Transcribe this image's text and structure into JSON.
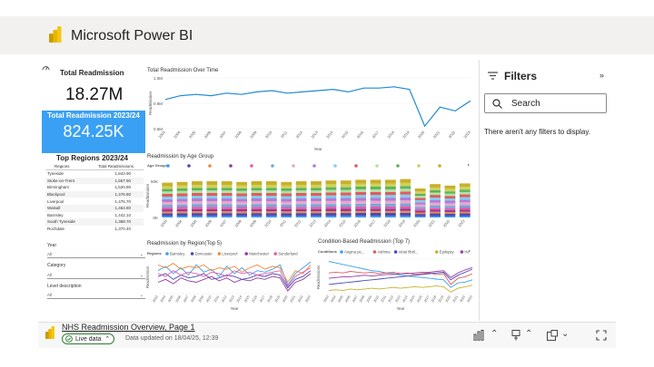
{
  "app": {
    "title": "Microsoft Power BI"
  },
  "kpi": {
    "label": "Total Readmission",
    "value": "18.27M"
  },
  "card2023": {
    "label": "Total Readmission 2023/24",
    "value": "824.25K"
  },
  "top_regions": {
    "title": "Top Regions 2023/24",
    "headers": [
      "Regions",
      "Total Readmissions"
    ],
    "rows": [
      [
        "Tyneside",
        "1,842.90"
      ],
      [
        "Stoke-on-Trent",
        "1,557.90"
      ],
      [
        "Birmingham",
        "1,520.90"
      ],
      [
        "Blackpool",
        "1,476.80"
      ],
      [
        "Liverpool",
        "1,475.70"
      ],
      [
        "Walsall",
        "1,464.80"
      ],
      [
        "Barnsley",
        "1,442.10"
      ],
      [
        "South Tyneside",
        "1,388.70"
      ],
      [
        "Rochdale",
        "1,370.40"
      ]
    ]
  },
  "slicers": [
    {
      "label": "Year",
      "value": "All"
    },
    {
      "label": "Category",
      "value": "All"
    },
    {
      "label": "Level description",
      "value": "All"
    }
  ],
  "visuals": {
    "over_time_title": "Total Readmission Over Time",
    "over_time_ylabel": "Readmission",
    "over_time_xlabel": "Year",
    "over_time_yticks": [
      "1.0M",
      "0.8M",
      "0.6M"
    ],
    "age_group_title": "Readmission by Age Group",
    "age_group_legend_label": "Age Groups",
    "age_group_ylabel": "Readmission",
    "age_group_yticks": [
      "50K",
      "0K"
    ],
    "region_title": "Readmission by Region(Top 5)",
    "region_legend_label": "Regions",
    "region_legend": [
      "Barnsley",
      "Doncaster",
      "Liverpool",
      "Manchester",
      "Sunderland"
    ],
    "region_ylabel": "Readmission",
    "region_xlabel": "Year",
    "condition_title": "Condition-Based Readmission (Top 7)",
    "condition_legend_label": "Conditions",
    "condition_legend": [
      "Angina pe...",
      "Asthma",
      "Atrial fibril...",
      "Epilepsy",
      "Heart fai..."
    ],
    "condition_ylabel": "Readmissions",
    "condition_xlabel": "Year"
  },
  "filters_pane": {
    "title": "Filters",
    "search_placeholder": "Search",
    "empty_text": "There aren't any filters to display."
  },
  "footer": {
    "page_link": "NHS Readmission Overview, Page 1",
    "live_label": "Live data",
    "updated": "Data updated on 18/04/25, 12:39"
  },
  "colors": {
    "accent_blue": "#3aa0f3",
    "line_blue": "#1f8ad6",
    "brand_yellow": "#f2c811"
  },
  "chart_data": [
    {
      "type": "line",
      "title": "Total Readmission Over Time",
      "xlabel": "Year",
      "ylabel": "Readmission",
      "x": [
        "2003",
        "2004",
        "2005",
        "2006",
        "2007",
        "2008",
        "2009",
        "2010",
        "2011",
        "2012",
        "2013",
        "2014",
        "2015",
        "2016",
        "2017",
        "2018",
        "2019",
        "2020",
        "2021",
        "2022",
        "2023"
      ],
      "values": [
        0.83,
        0.86,
        0.87,
        0.86,
        0.88,
        0.87,
        0.89,
        0.9,
        0.88,
        0.89,
        0.9,
        0.91,
        0.89,
        0.92,
        0.92,
        0.93,
        0.91,
        0.62,
        0.77,
        0.74,
        0.82
      ],
      "ylim": [
        0.6,
        1.0
      ]
    },
    {
      "type": "bar",
      "title": "Readmission by Age Group",
      "stacked": true,
      "categories": [
        "2003",
        "2004",
        "2005",
        "2006",
        "2007",
        "2008",
        "2009",
        "2010",
        "2011",
        "2012",
        "2013",
        "2014",
        "2015",
        "2016",
        "2017",
        "2018",
        "2019",
        "2020",
        "2021",
        "2022",
        "2023"
      ],
      "totals": [
        48,
        49,
        50,
        50,
        50,
        49,
        50,
        50,
        49,
        50,
        50,
        51,
        51,
        52,
        52,
        52,
        53,
        40,
        46,
        44,
        47
      ],
      "series_colors": [
        "#3aa0f3",
        "#4a4ab8",
        "#f08a3c",
        "#8e3a9a",
        "#e85aa8",
        "#6fa8dc",
        "#e9a7c9",
        "#b07dd6",
        "#7cd0f0",
        "#e05c5c",
        "#b2e0a4",
        "#5bb35b",
        "#d1d15a",
        "#c7b02a"
      ],
      "ylim": [
        0,
        60
      ]
    },
    {
      "type": "line",
      "title": "Readmission by Region(Top 5)",
      "xlabel": "Year",
      "ylabel": "Readmission",
      "series": [
        {
          "name": "Barnsley",
          "values": [
            3.2,
            3.5,
            3.0,
            3.4,
            2.9,
            3.6,
            3.1,
            3.3,
            2.8,
            3.5,
            3.0,
            3.4,
            2.9,
            3.2,
            3.1,
            3.3,
            3.6,
            2.2,
            3.0,
            3.4,
            3.8
          ]
        },
        {
          "name": "Doncaster",
          "values": [
            2.8,
            3.0,
            2.6,
            2.9,
            2.7,
            2.8,
            3.0,
            2.6,
            2.7,
            2.9,
            2.8,
            2.6,
            2.7,
            2.9,
            2.8,
            3.0,
            2.9,
            2.0,
            2.6,
            2.8,
            3.2
          ]
        },
        {
          "name": "Liverpool",
          "values": [
            3.6,
            3.4,
            3.7,
            3.3,
            3.5,
            3.4,
            3.6,
            3.2,
            3.4,
            3.3,
            3.5,
            3.1,
            3.4,
            3.6,
            3.3,
            3.5,
            3.4,
            2.4,
            3.2,
            3.0,
            3.6
          ]
        },
        {
          "name": "Manchester",
          "values": [
            2.4,
            2.6,
            2.3,
            2.7,
            2.5,
            2.4,
            2.6,
            2.8,
            2.5,
            2.7,
            2.4,
            2.6,
            2.5,
            2.7,
            2.6,
            2.8,
            2.7,
            1.8,
            2.4,
            2.6,
            3.0
          ]
        },
        {
          "name": "Sunderland",
          "values": [
            3.0,
            2.8,
            3.2,
            2.9,
            3.1,
            3.0,
            2.8,
            3.1,
            3.0,
            2.8,
            3.2,
            3.0,
            3.1,
            2.9,
            3.0,
            3.1,
            3.2,
            2.1,
            2.8,
            3.1,
            3.4
          ]
        }
      ]
    },
    {
      "type": "line",
      "title": "Condition-Based Readmission (Top 7)",
      "xlabel": "Year",
      "ylabel": "Readmissions",
      "series": [
        {
          "name": "Angina pe...",
          "values": [
            6.0,
            5.8,
            5.6,
            5.4,
            5.2,
            5.0,
            4.8,
            4.7,
            4.5,
            4.4,
            4.2,
            4.1,
            4.0,
            3.9,
            3.8,
            3.7,
            3.6,
            2.6,
            3.2,
            3.3,
            3.6
          ]
        },
        {
          "name": "Asthma",
          "values": [
            4.5,
            4.6,
            4.5,
            4.7,
            4.6,
            4.5,
            4.6,
            4.4,
            4.5,
            4.6,
            4.4,
            4.5,
            4.3,
            4.4,
            4.5,
            4.3,
            4.4,
            3.0,
            3.8,
            4.0,
            4.4
          ]
        },
        {
          "name": "Atrial fibril...",
          "values": [
            3.0,
            3.1,
            3.2,
            3.3,
            3.4,
            3.5,
            3.6,
            3.7,
            3.8,
            3.9,
            4.0,
            4.1,
            4.2,
            4.3,
            4.4,
            4.5,
            4.6,
            3.6,
            4.2,
            4.6,
            5.0
          ]
        },
        {
          "name": "Epilepsy",
          "values": [
            2.2,
            2.3,
            2.2,
            2.4,
            2.3,
            2.4,
            2.5,
            2.4,
            2.5,
            2.6,
            2.5,
            2.6,
            2.7,
            2.6,
            2.7,
            2.8,
            2.7,
            2.0,
            2.5,
            2.7,
            2.9
          ]
        },
        {
          "name": "Heart fai...",
          "values": [
            3.8,
            3.9,
            4.0,
            4.0,
            4.1,
            4.2,
            4.1,
            4.2,
            4.3,
            4.3,
            4.4,
            4.4,
            4.5,
            4.6,
            4.6,
            4.7,
            4.8,
            3.9,
            4.5,
            4.9,
            5.2
          ]
        }
      ],
      "series_colors": [
        "#3aa0f3",
        "#e05c5c",
        "#4a4ab8",
        "#c7b02a",
        "#9a3fa8"
      ]
    }
  ]
}
